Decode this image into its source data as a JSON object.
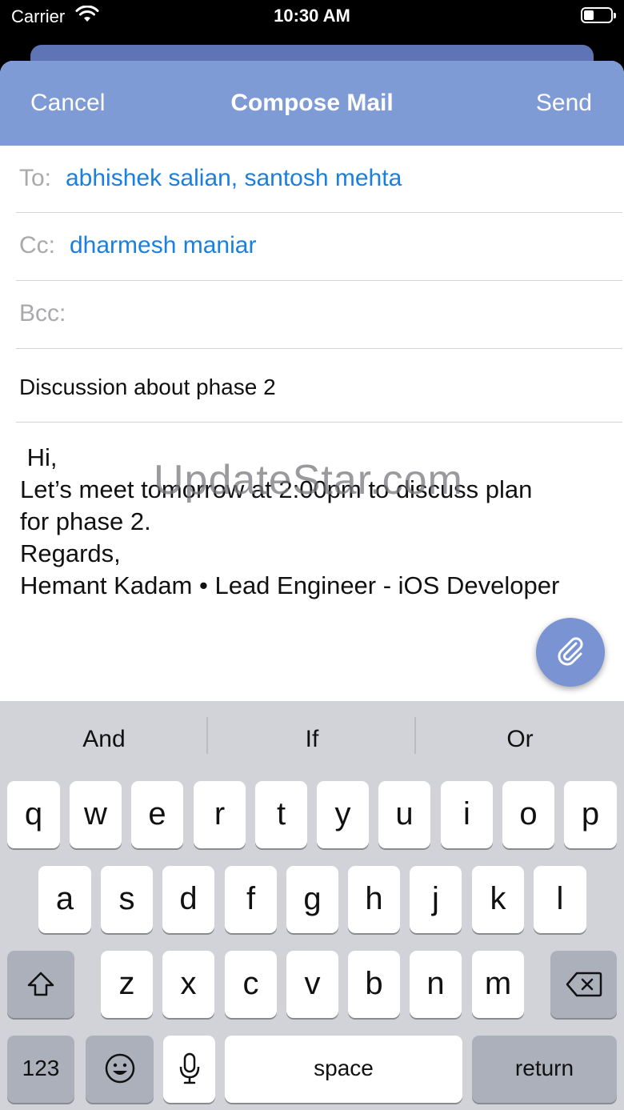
{
  "status_bar": {
    "carrier": "Carrier",
    "time": "10:30 AM"
  },
  "nav": {
    "cancel": "Cancel",
    "title": "Compose Mail",
    "send": "Send"
  },
  "fields": {
    "to_label": "To:",
    "to_value": "abhishek salian, santosh mehta",
    "cc_label": "Cc:",
    "cc_value": "dharmesh maniar",
    "bcc_label": "Bcc:",
    "subject": "Discussion about phase 2"
  },
  "body": {
    "lines": [
      " Hi,",
      "",
      "Let’s meet tomorrow at 2:00pm to discuss plan",
      "for phase 2.",
      "",
      "",
      "Regards,",
      "Hemant Kadam • Lead Engineer - iOS Developer"
    ]
  },
  "watermark": "UpdateStar.com",
  "keyboard": {
    "suggestions": [
      "And",
      "If",
      "Or"
    ],
    "row1": [
      "q",
      "w",
      "e",
      "r",
      "t",
      "y",
      "u",
      "i",
      "o",
      "p"
    ],
    "row2": [
      "a",
      "s",
      "d",
      "f",
      "g",
      "h",
      "j",
      "k",
      "l"
    ],
    "row3": [
      "z",
      "x",
      "c",
      "v",
      "b",
      "n",
      "m"
    ],
    "numbers_key": "123",
    "space_key": "space",
    "return_key": "return"
  },
  "colors": {
    "nav_bar": "#7f9bd5",
    "recipient": "#1a7fde",
    "fab": "#7a93d2"
  },
  "icons": [
    "wifi-icon",
    "battery-icon",
    "paperclip-icon",
    "shift-icon",
    "backspace-icon",
    "emoji-icon",
    "microphone-icon"
  ]
}
